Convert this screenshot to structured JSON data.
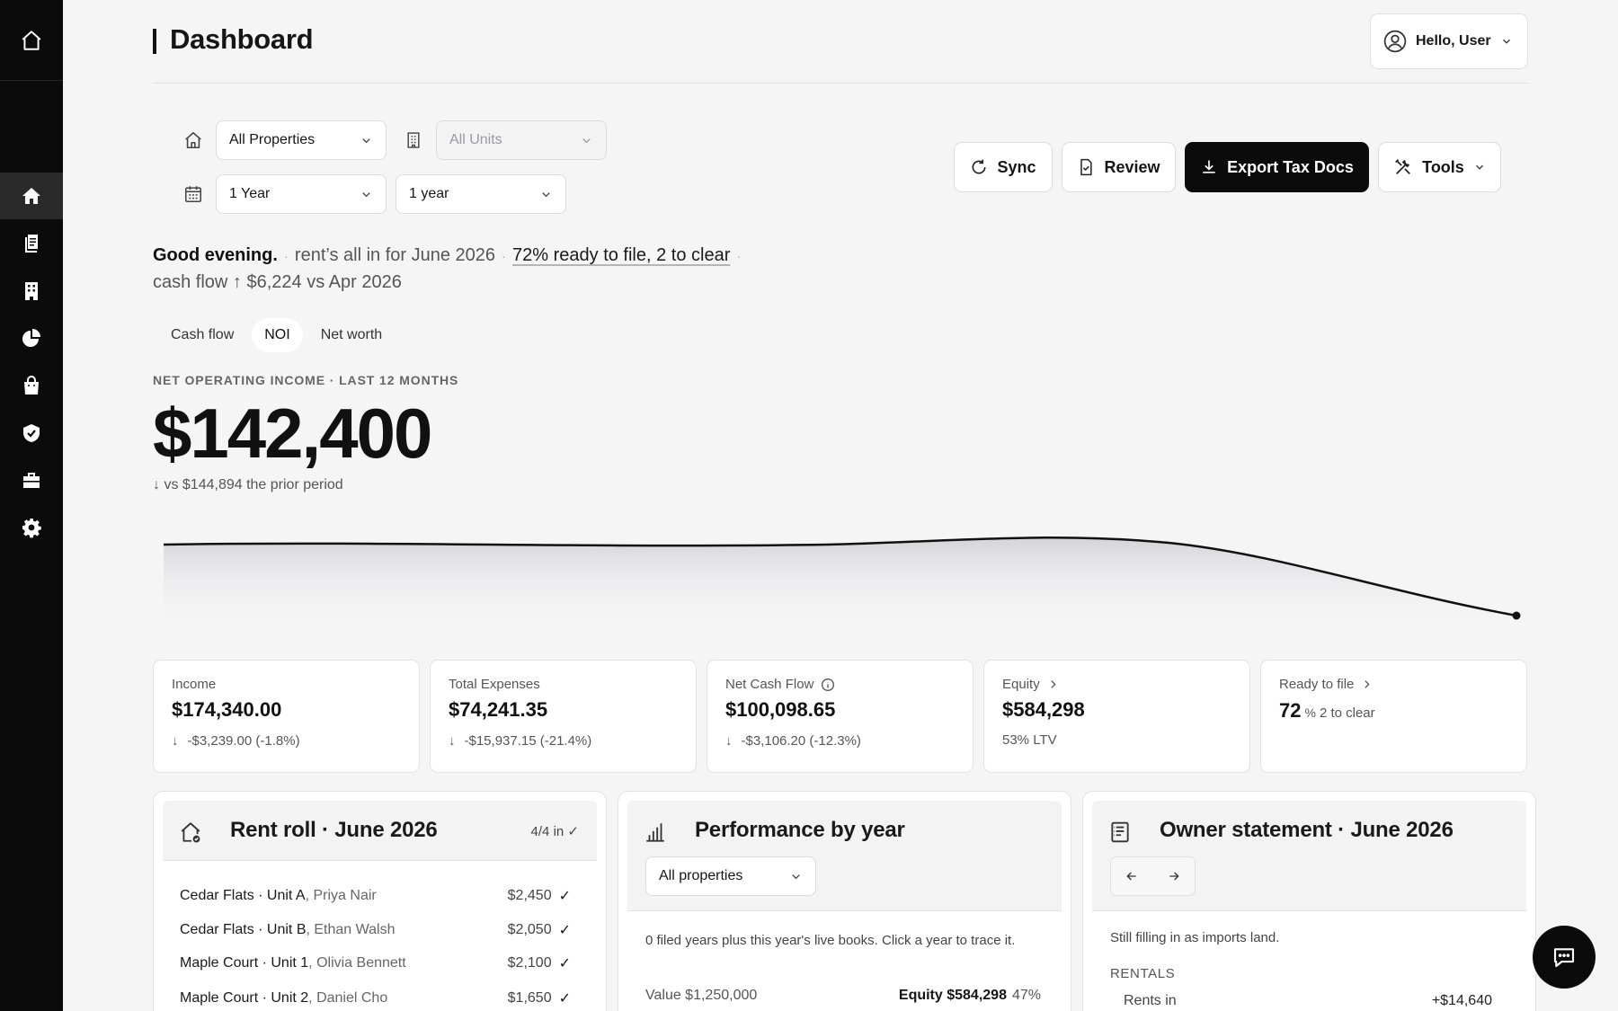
{
  "header": {
    "title": "Dashboard",
    "user_label": "Hello, User"
  },
  "filters": {
    "property": "All Properties",
    "unit": "All Units",
    "period": "1 Year",
    "range": "1 year"
  },
  "actions": {
    "sync": "Sync",
    "review": "Review",
    "export": "Export Tax Docs",
    "tools": "Tools"
  },
  "greeting": {
    "hello": "Good evening.",
    "rent": "rent’s all in for June 2026",
    "ready": "72% ready to file, 2 to clear",
    "cashflow": "cash flow ↑ $6,224 vs Apr 2026"
  },
  "tabs": [
    "Cash flow",
    "NOI",
    "Net worth"
  ],
  "active_tab": "NOI",
  "metric": {
    "label": "NET OPERATING INCOME · LAST 12 MONTHS",
    "value": "$142,400",
    "compare": "vs $144,894 the prior period"
  },
  "kpis": [
    {
      "label": "Income",
      "value": "$174,340.00",
      "sub": "-$3,239.00 (-1.8%)"
    },
    {
      "label": "Total Expenses",
      "value": "$74,241.35",
      "sub": "-$15,937.15 (-21.4%)"
    },
    {
      "label": "Net Cash Flow",
      "value": "$100,098.65",
      "sub": "-$3,106.20 (-12.3%)"
    },
    {
      "label": "Equity",
      "value": "$584,298",
      "sub": "53% LTV"
    },
    {
      "label": "Ready to file",
      "value": "72",
      "pct": "%",
      "sub": "2 to clear"
    }
  ],
  "rent_roll": {
    "title": "Rent roll ·",
    "month": "June 2026",
    "badge": "4/4 in",
    "rows": [
      {
        "unit": "Cedar Flats · Unit A",
        "tenant": "Priya Nair",
        "amount": "$2,450"
      },
      {
        "unit": "Cedar Flats · Unit B",
        "tenant": "Ethan Walsh",
        "amount": "$2,050"
      },
      {
        "unit": "Maple Court · Unit 1",
        "tenant": "Olivia Bennett",
        "amount": "$2,100"
      },
      {
        "unit": "Maple Court · Unit 2",
        "tenant": "Daniel Cho",
        "amount": "$1,650"
      }
    ]
  },
  "performance": {
    "title": "Performance by year",
    "select": "All properties",
    "note": "0 filed years plus this year's live books. Click a year to trace it.",
    "value_label": "Value $1,250,000",
    "equity_label": "Equity $584,298",
    "equity_pct": "47%"
  },
  "owner_statement": {
    "title": "Owner statement ·",
    "month": "June 2026",
    "note": "Still filling in as imports land.",
    "section": "RENTALS",
    "row_label": "Rents in",
    "row_value": "+$14,640"
  },
  "colors": {
    "accent": "#0b0b0b",
    "background": "#f5f5f6"
  }
}
